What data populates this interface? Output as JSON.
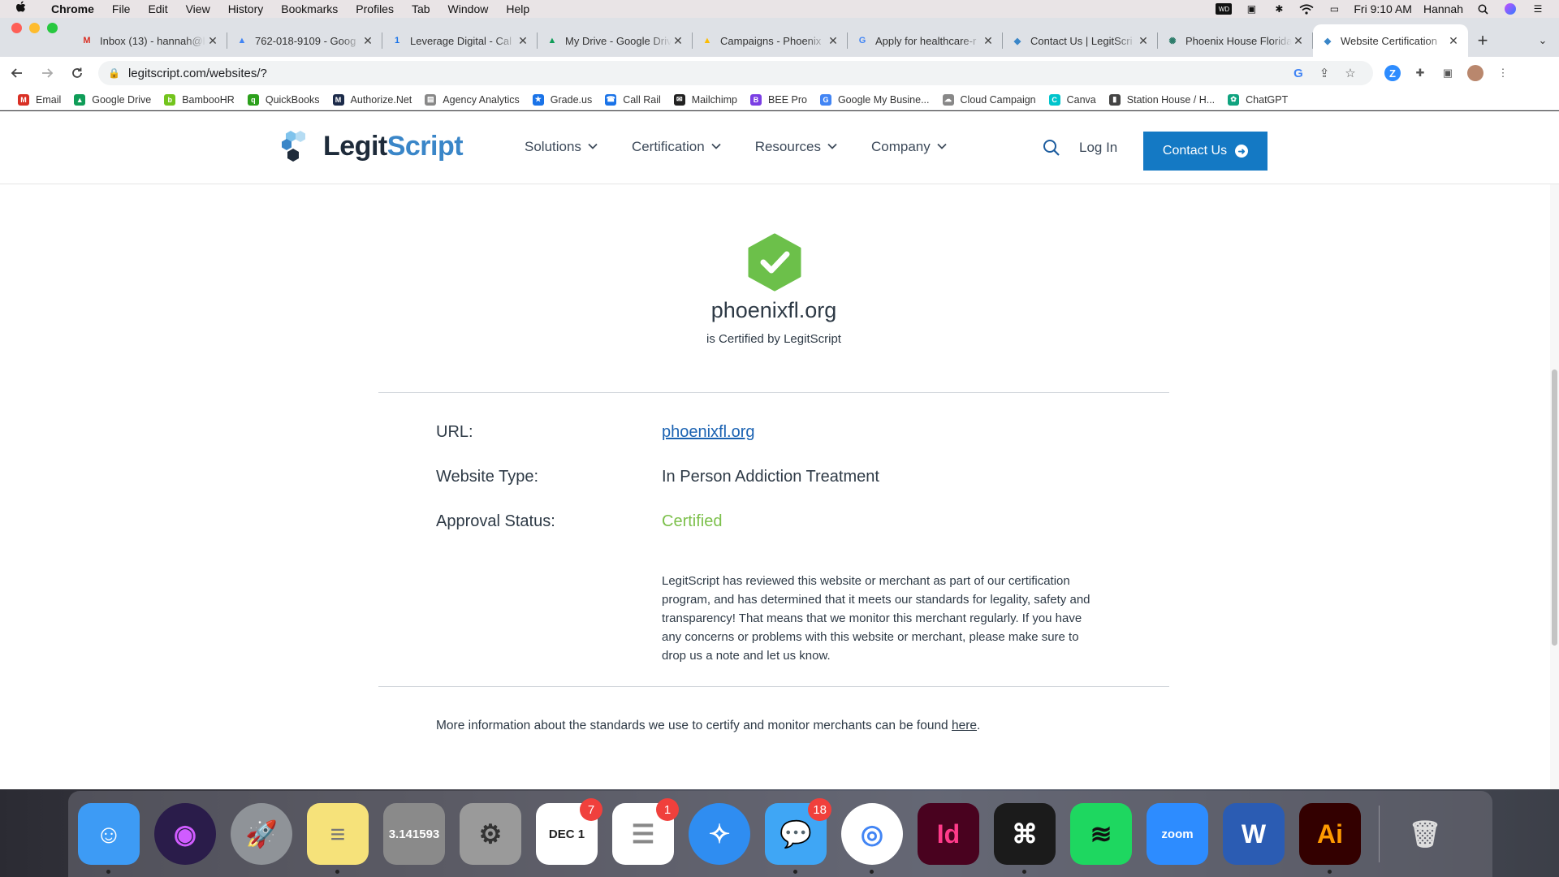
{
  "menubar": {
    "app": "Chrome",
    "items": [
      "File",
      "Edit",
      "View",
      "History",
      "Bookmarks",
      "Profiles",
      "Tab",
      "Window",
      "Help"
    ],
    "clock": "Fri 9:10 AM",
    "user": "Hannah",
    "status_icons": [
      "wd-icon",
      "screen-icon",
      "bluetooth-icon",
      "wifi-icon",
      "airplay-icon"
    ]
  },
  "tabs": [
    {
      "title": "Inbox (13) - hannah@l",
      "icon": "gmail-icon",
      "glyph": "M",
      "color": "#d93025"
    },
    {
      "title": "762-018-9109 - Goog",
      "icon": "google-ads-icon",
      "glyph": "▲",
      "color": "#4285f4"
    },
    {
      "title": "Leverage Digital - Cal",
      "icon": "calendar-icon",
      "glyph": "1",
      "color": "#1a73e8"
    },
    {
      "title": "My Drive - Google Driv",
      "icon": "drive-icon",
      "glyph": "▲",
      "color": "#0f9d58"
    },
    {
      "title": "Campaigns - Phoenix",
      "icon": "google-ads-icon",
      "glyph": "▲",
      "color": "#fbbc04"
    },
    {
      "title": "Apply for healthcare-r",
      "icon": "google-icon",
      "glyph": "G",
      "color": "#4285f4"
    },
    {
      "title": "Contact Us | LegitScri",
      "icon": "legitscript-icon",
      "glyph": "◆",
      "color": "#3a86c8"
    },
    {
      "title": "Phoenix House Florida",
      "icon": "phoenix-icon",
      "glyph": "✺",
      "color": "#2e7d6b"
    },
    {
      "title": "Website Certification",
      "icon": "legitscript-icon",
      "glyph": "◆",
      "color": "#3a86c8"
    }
  ],
  "toolbar": {
    "url": "legitscript.com/websites/?"
  },
  "bookmarks": [
    {
      "label": "Email",
      "icon": "gmail-icon",
      "glyph": "M",
      "color": "#d93025"
    },
    {
      "label": "Google Drive",
      "icon": "drive-icon",
      "glyph": "▲",
      "color": "#0f9d58"
    },
    {
      "label": "BambooHR",
      "icon": "bamboohr-icon",
      "glyph": "b",
      "color": "#73c41d"
    },
    {
      "label": "QuickBooks",
      "icon": "quickbooks-icon",
      "glyph": "q",
      "color": "#2ca01c"
    },
    {
      "label": "Authorize.Net",
      "icon": "authorize-icon",
      "glyph": "M",
      "color": "#1c2b4a"
    },
    {
      "label": "Agency Analytics",
      "icon": "analytics-icon",
      "glyph": "▤",
      "color": "#888888"
    },
    {
      "label": "Grade.us",
      "icon": "gradeus-icon",
      "glyph": "★",
      "color": "#1a73e8"
    },
    {
      "label": "Call Rail",
      "icon": "callrail-icon",
      "glyph": "☎",
      "color": "#1a73e8"
    },
    {
      "label": "Mailchimp",
      "icon": "mailchimp-icon",
      "glyph": "✉",
      "color": "#222222"
    },
    {
      "label": "BEE Pro",
      "icon": "beepro-icon",
      "glyph": "B",
      "color": "#7b3fe4"
    },
    {
      "label": "Google My Busine...",
      "icon": "google-icon",
      "glyph": "G",
      "color": "#4285f4"
    },
    {
      "label": "Cloud Campaign",
      "icon": "cloud-icon",
      "glyph": "☁",
      "color": "#888888"
    },
    {
      "label": "Canva",
      "icon": "canva-icon",
      "glyph": "C",
      "color": "#00c4cc"
    },
    {
      "label": "Station House / H...",
      "icon": "station-icon",
      "glyph": "▮",
      "color": "#444444"
    },
    {
      "label": "ChatGPT",
      "icon": "chatgpt-icon",
      "glyph": "✿",
      "color": "#10a37f"
    }
  ],
  "site": {
    "logo_legit": "Legit",
    "logo_script": "Script",
    "nav": [
      "Solutions",
      "Certification",
      "Resources",
      "Company"
    ],
    "login": "Log In",
    "contact": "Contact Us"
  },
  "certification": {
    "domain": "phoenixfl.org",
    "certified_by": "is Certified by LegitScript",
    "url_label": "URL:",
    "url_value": "phoenixfl.org",
    "type_label": "Website Type:",
    "type_value": "In Person Addiction Treatment",
    "status_label": "Approval Status:",
    "status_value": "Certified",
    "status_color": "#7cc04b",
    "description": "LegitScript has reviewed this website or merchant as part of our certification program, and has determined that it meets our standards for legality, safety and transparency! That means that we monitor this merchant regularly. If you have any concerns or problems with this website or merchant, please make sure to drop us a note and let us know.",
    "more_info_prefix": "More information about the standards we use to certify and monitor merchants can be found ",
    "more_info_link": "here",
    "more_info_suffix": "."
  },
  "dock": [
    {
      "name": "finder-icon",
      "glyph": "☺",
      "bg": "#3d9bf5",
      "fg": "#fff",
      "dot": true
    },
    {
      "name": "siri-icon",
      "glyph": "◉",
      "bg": "#2a1c4a",
      "fg": "#d05cff",
      "dot": false
    },
    {
      "name": "launchpad-icon",
      "glyph": "🚀",
      "bg": "#8f9398",
      "fg": "#fff",
      "dot": false
    },
    {
      "name": "notes-icon",
      "glyph": "≡",
      "bg": "#f6e27a",
      "fg": "#777",
      "dot": true
    },
    {
      "name": "calculator-icon",
      "glyph": "3.141593",
      "bg": "#8a8a8a",
      "fg": "#fff",
      "dot": false
    },
    {
      "name": "system-preferences-icon",
      "glyph": "⚙",
      "bg": "#9a9a9a",
      "fg": "#333",
      "dot": false
    },
    {
      "name": "calendar-icon",
      "glyph": "DEC 1",
      "bg": "#ffffff",
      "fg": "#222",
      "dot": false,
      "badge": "7"
    },
    {
      "name": "reminders-icon",
      "glyph": "☰",
      "bg": "#ffffff",
      "fg": "#888",
      "dot": false,
      "badge": "1"
    },
    {
      "name": "safari-icon",
      "glyph": "✧",
      "bg": "#2f8df1",
      "fg": "#fff",
      "dot": false
    },
    {
      "name": "messages-icon",
      "glyph": "💬",
      "bg": "#3fa6f5",
      "fg": "#fff",
      "dot": true,
      "badge": "18"
    },
    {
      "name": "chrome-icon",
      "glyph": "◎",
      "bg": "#ffffff",
      "fg": "#4285f4",
      "dot": true
    },
    {
      "name": "indesign-icon",
      "glyph": "Id",
      "bg": "#49021f",
      "fg": "#ff3b8a",
      "dot": false
    },
    {
      "name": "acrobat-icon",
      "glyph": "⌘",
      "bg": "#1b1b1b",
      "fg": "#fff",
      "dot": true
    },
    {
      "name": "spotify-icon",
      "glyph": "≋",
      "bg": "#1ed760",
      "fg": "#111",
      "dot": false
    },
    {
      "name": "zoom-icon",
      "glyph": "zoom",
      "bg": "#2d8cff",
      "fg": "#fff",
      "dot": false
    },
    {
      "name": "word-icon",
      "glyph": "W",
      "bg": "#2b5cb3",
      "fg": "#fff",
      "dot": false
    },
    {
      "name": "illustrator-icon",
      "glyph": "Ai",
      "bg": "#330000",
      "fg": "#ff9a00",
      "dot": true
    },
    {
      "name": "trash-icon",
      "glyph": "🗑",
      "bg": "transparent",
      "fg": "#ddd",
      "dot": false
    }
  ]
}
